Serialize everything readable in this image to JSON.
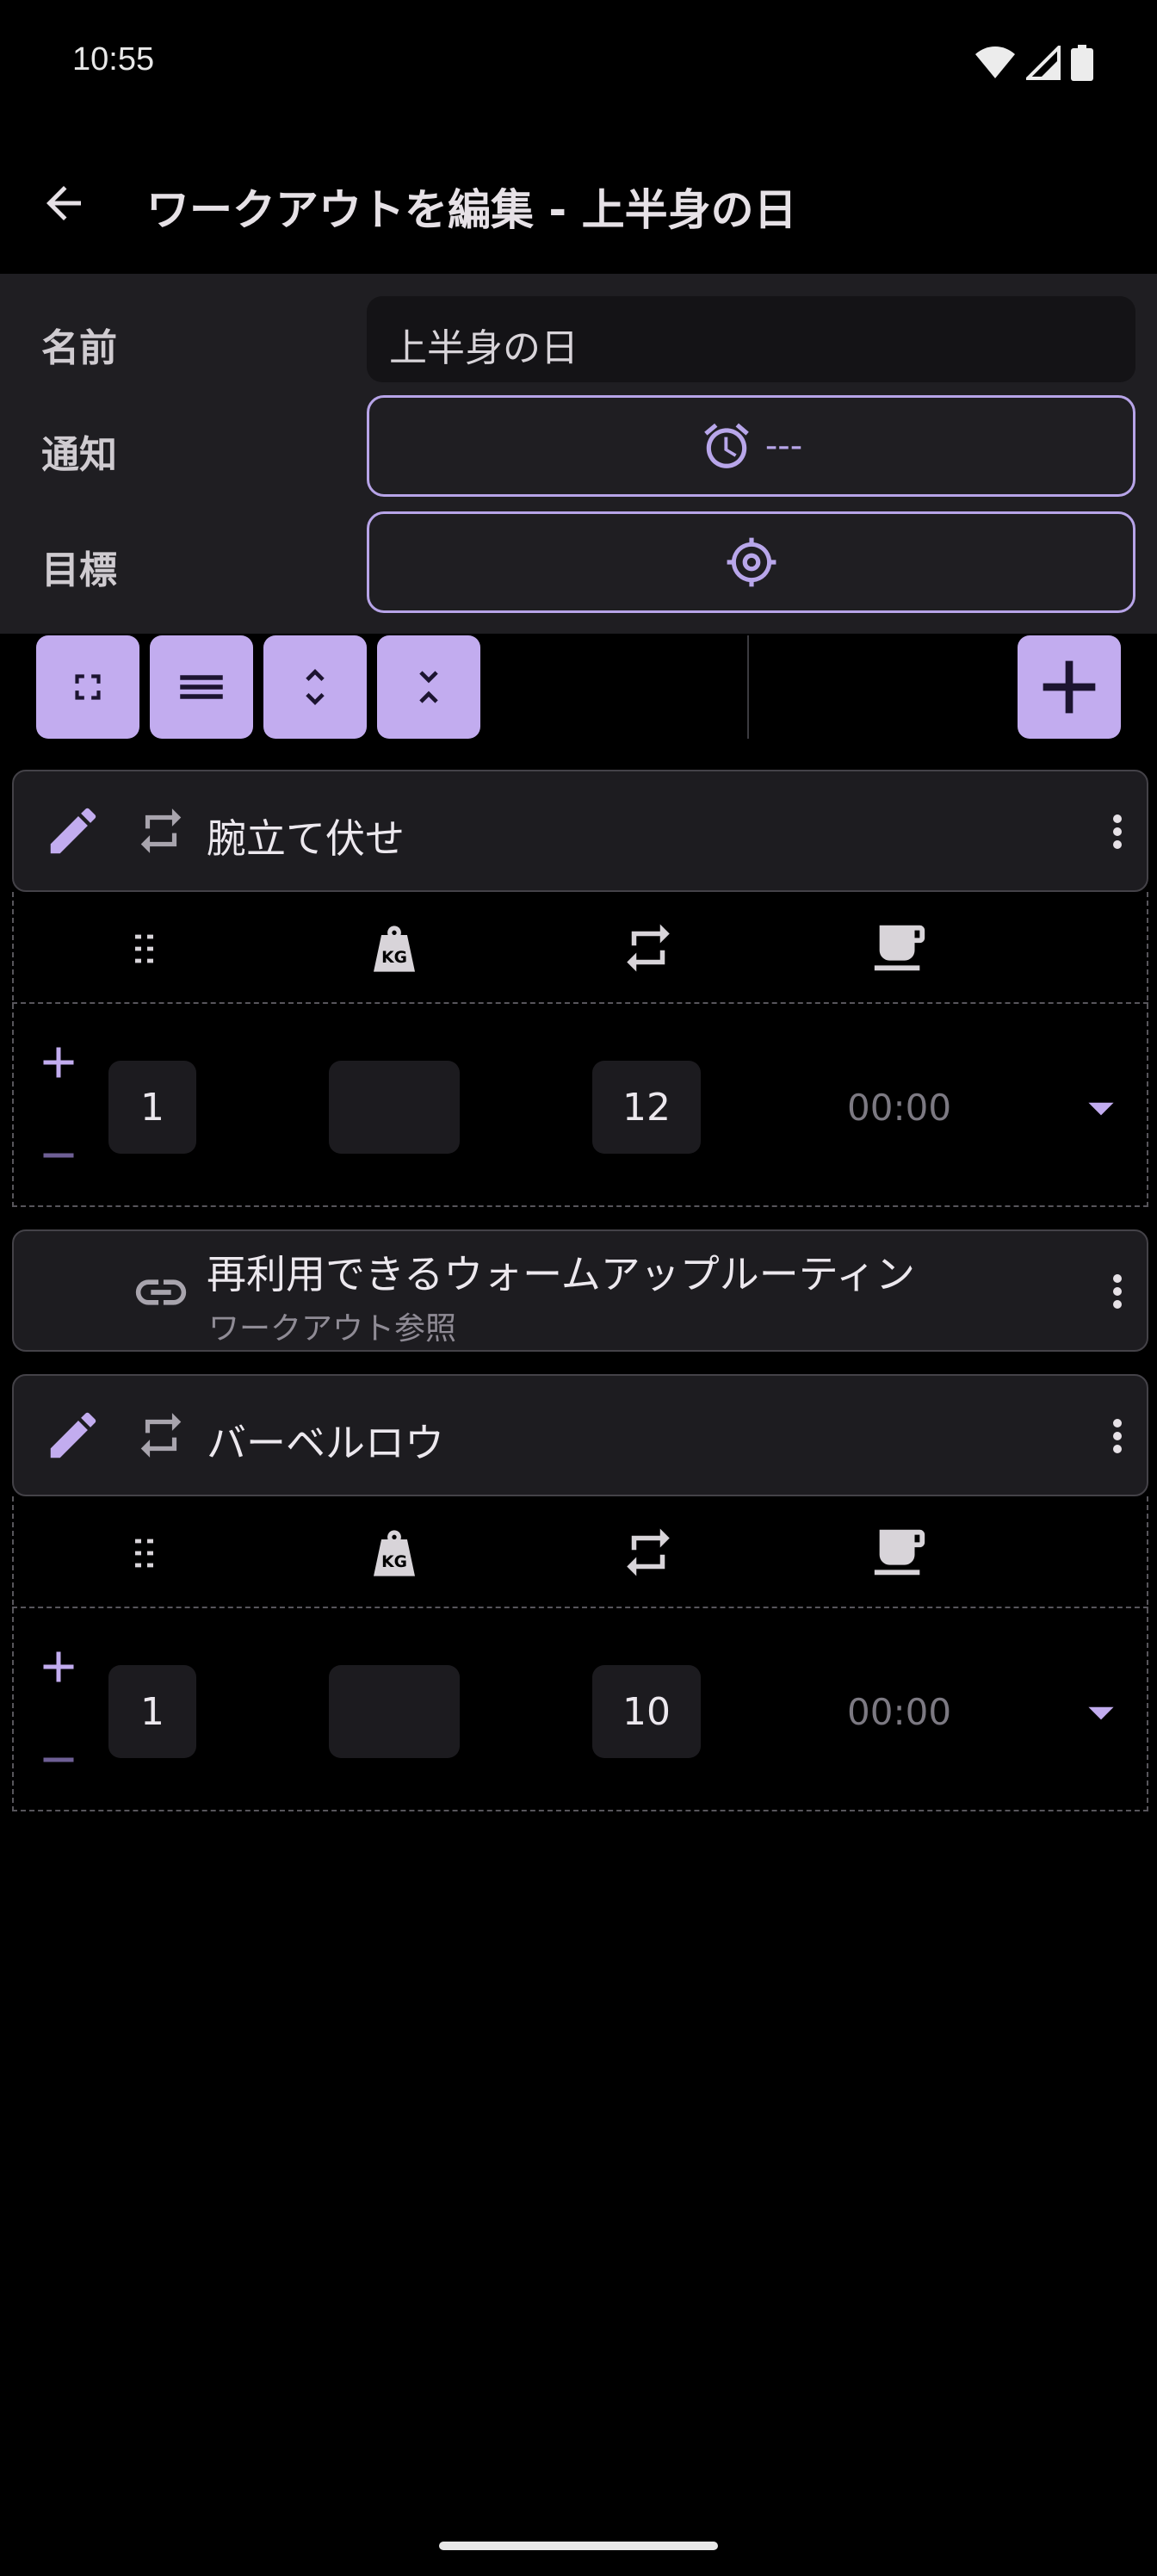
{
  "status_bar": {
    "time": "10:55"
  },
  "app_bar": {
    "title": "ワークアウトを編集 - 上半身の日"
  },
  "form": {
    "name_label": "名前",
    "name_value": "上半身の日",
    "notification_label": "通知",
    "notification_value": "---",
    "goal_label": "目標"
  },
  "exercises": [
    {
      "name": "腕立て伏せ",
      "set": {
        "sets": "1",
        "weight": "",
        "reps": "12",
        "rest": "00:00"
      }
    },
    {
      "name": "再利用できるウォームアップルーティン",
      "subtitle": "ワークアウト参照"
    },
    {
      "name": "バーベルロウ",
      "set": {
        "sets": "1",
        "weight": "",
        "reps": "10",
        "rest": "00:00"
      }
    }
  ],
  "colors": {
    "accent": "#c2acef",
    "background": "#000000",
    "surface": "#1f1e22"
  }
}
